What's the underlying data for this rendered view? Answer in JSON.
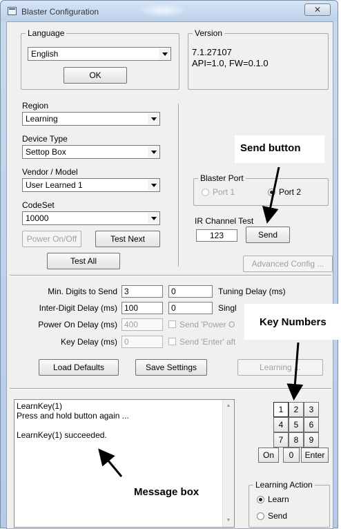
{
  "window": {
    "title": "Blaster Configuration",
    "close_glyph": "✕"
  },
  "language": {
    "legend": "Language",
    "selected": "English",
    "ok_label": "OK"
  },
  "version": {
    "legend": "Version",
    "line1": "7.1.27107",
    "line2": "API=1.0, FW=0.1.0"
  },
  "region": {
    "label": "Region",
    "selected": "Learning"
  },
  "device_type": {
    "label": "Device Type",
    "selected": "Settop Box"
  },
  "vendor_model": {
    "label": "Vendor / Model",
    "selected": "User Learned 1"
  },
  "codeset": {
    "label": "CodeSet",
    "selected": "10000"
  },
  "buttons": {
    "power_onoff": "Power On/Off",
    "test_next": "Test Next",
    "test_all": "Test All",
    "send": "Send",
    "advanced_config": "Advanced Config ...",
    "load_defaults": "Load Defaults",
    "save_settings": "Save Settings",
    "learning": "Learning ..."
  },
  "blaster_port": {
    "legend": "Blaster Port",
    "port1": "Port 1",
    "port2": "Port 2",
    "selected": "Port 2"
  },
  "ir_channel_test": {
    "label": "IR Channel Test",
    "value": "123"
  },
  "settings": {
    "min_digits_label": "Min. Digits to Send",
    "min_digits_value": "3",
    "tuning_delay_value": "0",
    "tuning_delay_label": "Tuning Delay (ms)",
    "inter_digit_label": "Inter-Digit Delay (ms)",
    "inter_digit_value": "100",
    "single_digit_value": "0",
    "single_digit_label": "Singl",
    "power_on_delay_label": "Power On Delay (ms)",
    "power_on_delay_value": "400",
    "send_power_label": "Send 'Power O",
    "key_delay_label": "Key Delay (ms)",
    "key_delay_value": "0",
    "send_enter_label": "Send 'Enter' aft"
  },
  "message_box": {
    "lines": [
      "LearnKey(1)",
      "Press and hold button again ...",
      "",
      "LearnKey(1) succeeded."
    ],
    "scroll_up_glyph": "▲",
    "scroll_down_glyph": "▼"
  },
  "keypad": {
    "keys": [
      "1",
      "2",
      "3",
      "4",
      "5",
      "6",
      "7",
      "8",
      "9",
      "On",
      "0",
      "Enter"
    ],
    "selected": "1"
  },
  "learning_action": {
    "legend": "Learning Action",
    "learn": "Learn",
    "send": "Send",
    "selected": "Learn"
  },
  "annotations": {
    "send_button": "Send button",
    "key_numbers": "Key Numbers",
    "message_box": "Message box"
  }
}
